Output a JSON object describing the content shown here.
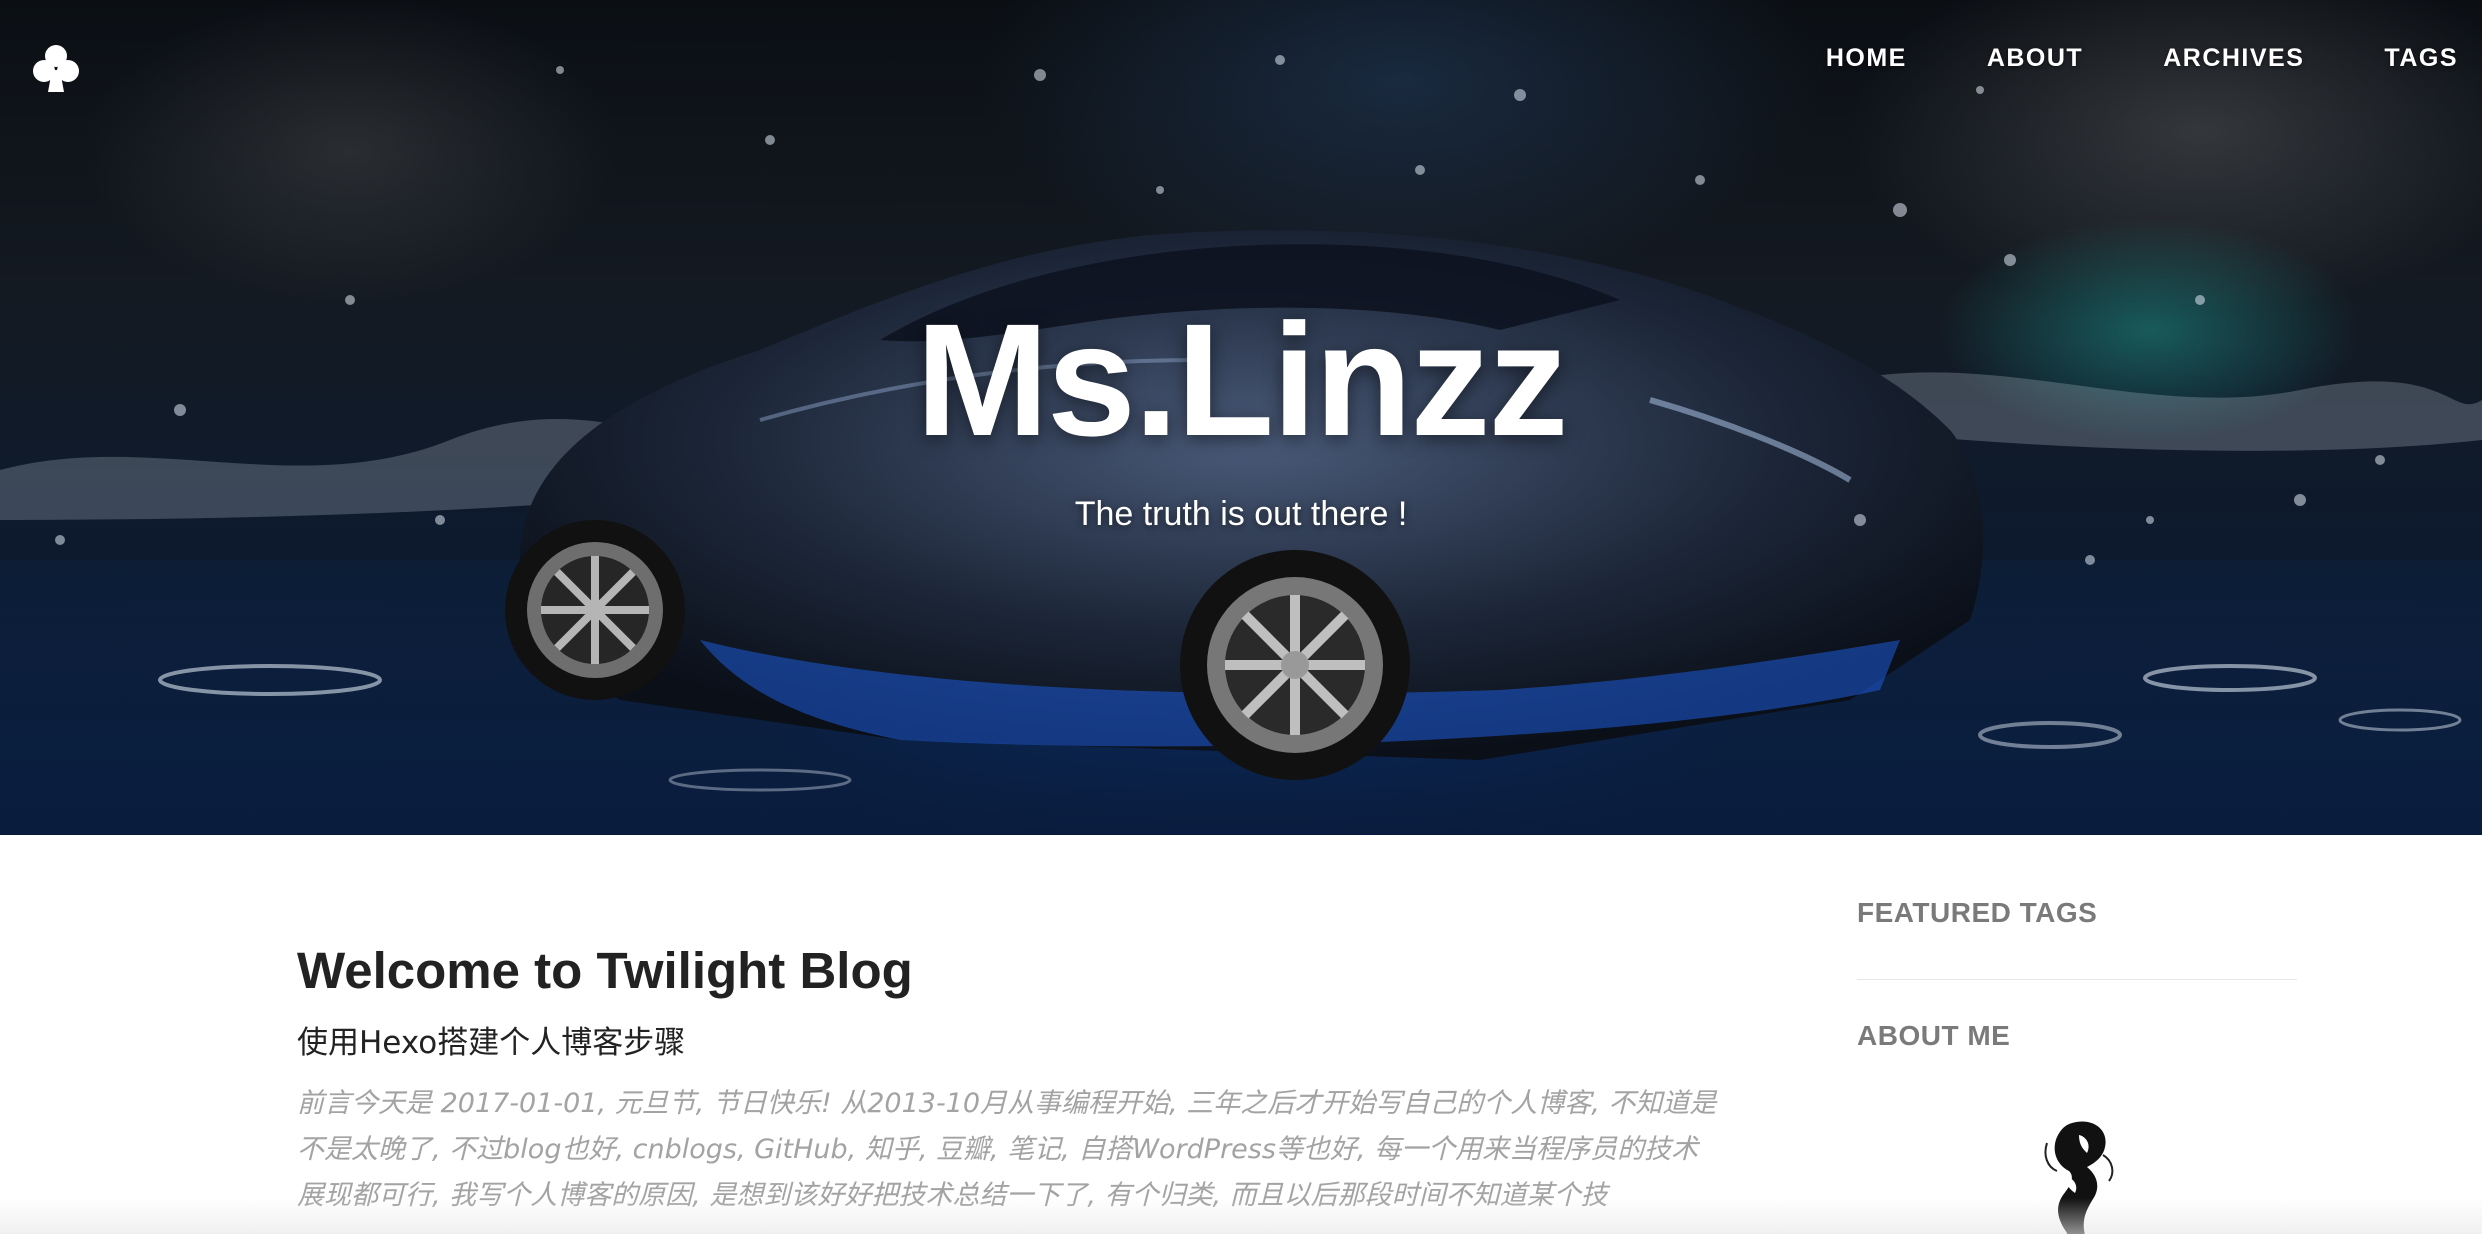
{
  "site": {
    "title": "Ms.Linzz",
    "subtitle": "The truth is out there !",
    "logo_icon": "club-suit-icon"
  },
  "nav": {
    "items": [
      {
        "label": "HOME"
      },
      {
        "label": "ABOUT"
      },
      {
        "label": "ARCHIVES"
      },
      {
        "label": "TAGS"
      }
    ]
  },
  "post": {
    "title": "Welcome to Twilight Blog",
    "subtitle": "使用Hexo搭建个人博客步骤",
    "excerpt": "前言今天是 2017-01-01, 元旦节, 节日快乐! 从2013-10月从事编程开始, 三年之后才开始写自己的个人博客, 不知道是不是太晚了, 不过blog也好, cnblogs, GitHub, 知乎, 豆瓣, 笔记, 自搭WordPress等也好, 每一个用来当程序员的技术展现都可行, 我写个人博客的原因, 是想到该好好把技术总结一下了, 有个归类, 而且以后那段时间不知道某个技"
  },
  "sidebar": {
    "featured_tags_heading": "FEATURED TAGS",
    "about_me_heading": "ABOUT ME",
    "avatar_icon": "avatar"
  },
  "colors": {
    "nav_text": "#ffffff",
    "post_title": "#222222",
    "excerpt": "#a3a3a3",
    "sidebar_heading": "#7a7a7a"
  }
}
